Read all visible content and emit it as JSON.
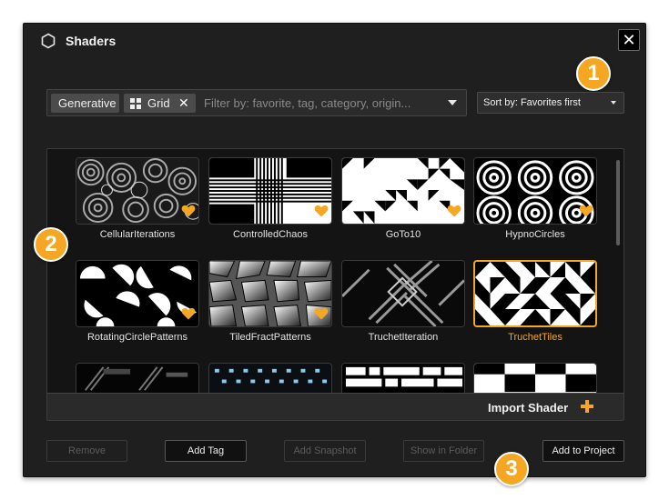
{
  "window": {
    "title": "Shaders",
    "close_label": "✕"
  },
  "filter": {
    "tags": [
      {
        "label": "Generative"
      },
      {
        "label": "Grid",
        "remove": "✕"
      }
    ],
    "placeholder": "Filter by: favorite, tag, category, origin..."
  },
  "sort": {
    "selected": "Sort by: Favorites first"
  },
  "shaders": [
    {
      "name": "CellularIterations",
      "favorite": true,
      "selected": false
    },
    {
      "name": "ControlledChaos",
      "favorite": true,
      "selected": false
    },
    {
      "name": "GoTo10",
      "favorite": true,
      "selected": false
    },
    {
      "name": "HypnoCircles",
      "favorite": true,
      "selected": false
    },
    {
      "name": "RotatingCirclePatterns",
      "favorite": true,
      "selected": false
    },
    {
      "name": "TiledFractPatterns",
      "favorite": true,
      "selected": false
    },
    {
      "name": "TruchetIteration",
      "favorite": false,
      "selected": false
    },
    {
      "name": "TruchetTiles",
      "favorite": false,
      "selected": true
    }
  ],
  "import": {
    "label": "Import Shader"
  },
  "footer": {
    "remove": "Remove",
    "add_tag": "Add Tag",
    "add_snapshot": "Add Snapshot",
    "show_in_folder": "Show in Folder",
    "add_to_project": "Add to Project"
  },
  "markers": [
    "1",
    "2",
    "3"
  ],
  "colors": {
    "accent": "#f5a623",
    "window_bg": "#1f1f1f",
    "library_bg": "#141414"
  }
}
